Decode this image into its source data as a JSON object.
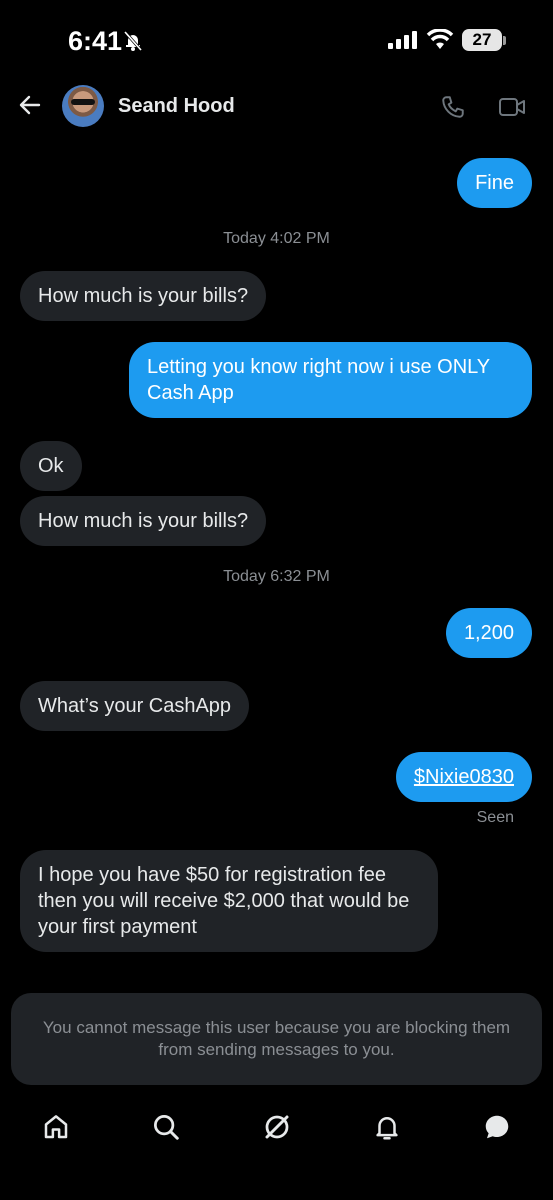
{
  "status_bar": {
    "time": "6:41",
    "battery": "27"
  },
  "header": {
    "contact_name": "Seand Hood"
  },
  "messages": [
    {
      "type": "out",
      "text": "Fine"
    },
    {
      "type": "timestamp",
      "text": "Today 4:02 PM"
    },
    {
      "type": "in",
      "text": "How much is your bills?"
    },
    {
      "type": "out",
      "text": "Letting you know right now i use ONLY Cash App"
    },
    {
      "type": "in",
      "text": "Ok"
    },
    {
      "type": "in",
      "text": "How much is your bills?"
    },
    {
      "type": "timestamp",
      "text": "Today 6:32 PM"
    },
    {
      "type": "out",
      "text": "1,200"
    },
    {
      "type": "in",
      "text": "What’s your CashApp"
    },
    {
      "type": "out",
      "text": "$Nixie0830"
    },
    {
      "type": "status",
      "text": "Seen"
    },
    {
      "type": "in",
      "text": "I hope you have $50 for registration fee then you will receive $2,000 that would be your first payment"
    }
  ],
  "notice": {
    "text": "You cannot message this user because you are blocking them from sending messages to you."
  },
  "icons": [
    "back-arrow-icon",
    "phone-icon",
    "video-icon",
    "home-icon",
    "search-icon",
    "grok-icon",
    "bell-icon",
    "messages-icon"
  ],
  "colors": {
    "accent": "#1d9bf0",
    "incoming_bubble": "#202327",
    "background": "#000000"
  }
}
